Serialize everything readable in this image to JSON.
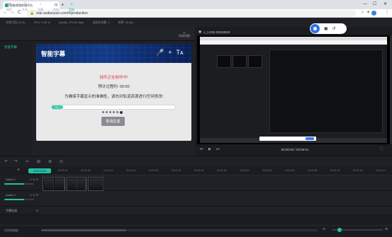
{
  "browser": {
    "tab_title": "智能视频剪辑平台",
    "tab_close": "×",
    "new_tab": "+",
    "url": "edu.aodianyun.com/#/production",
    "lock": "🔒",
    "nav_back": "←",
    "nav_forward": "→",
    "nav_reload": "C",
    "window_min": "—",
    "window_max": "☐",
    "window_close": "✕"
  },
  "app": {
    "status": {
      "memory": "本地可用 (1/10)",
      "cpu": "CPU: 3.56 %",
      "net": "net(fd): 270.55 kbps",
      "jobs": "当前任务数: 1",
      "fps": "帧率: 30 fps"
    },
    "left_tools": [
      {
        "icon": "▦",
        "label": "媒资"
      },
      {
        "icon": "T",
        "label": "文本"
      },
      {
        "icon": "◔",
        "label": "字幕"
      },
      {
        "icon": "▤",
        "label": "特效"
      },
      {
        "icon": "✧",
        "label": "智能"
      }
    ],
    "right_tool": {
      "icon": "▭",
      "label": "布局切换"
    },
    "sidebar_item": "智能字幕",
    "preview": {
      "title": "v_1.232.20210624",
      "timecode": "00:00:00 / 00:59:01",
      "recorder_icons": [
        "▣",
        "↺"
      ]
    },
    "dialog": {
      "title": "智能字幕",
      "header_icons": [
        "🎤",
        "+",
        "Tᴀ"
      ],
      "warning": "插件正在制作中!",
      "eta": "预计过程约: 00:00",
      "note": "为确保字幕显示的准确性，请勿对轨道资源进行任何修改!",
      "progress_pct": 0.07,
      "progress_label": "7%",
      "cancel_label": "取消生成"
    },
    "timeline": {
      "toolbar": [
        "↶",
        "↷",
        "✂",
        "⊞",
        "⊕",
        "◴"
      ],
      "playhead_label": "00:00:00:00",
      "ticks": [
        "00:00:00",
        "00:00:05",
        "00:00:10",
        "00:00:15",
        "00:00:20",
        "00:00:25",
        "00:00:30",
        "00:00:35",
        "00:00:40",
        "00:00:45",
        "00:00:50",
        "00:00:55",
        "00:01:00",
        "00:01:05",
        "00:01:10",
        "00:01:15"
      ],
      "tracks": [
        {
          "name": "Video 0",
          "icons": "⊙ ◎ ⊟"
        },
        {
          "name": "Audio 0",
          "icons": "⊙ ◎ ⊟"
        },
        {
          "name": "字幕轨道",
          "icons": "⊟"
        }
      ],
      "add_track": "+",
      "bottom_label": "时间线缩放"
    }
  }
}
